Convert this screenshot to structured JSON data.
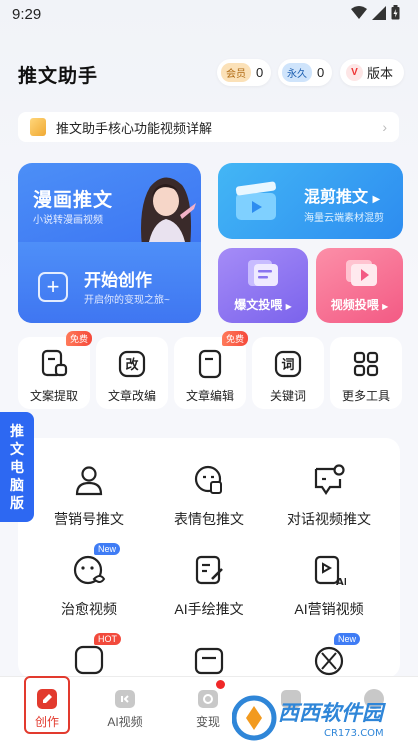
{
  "status_bar": {
    "time": "9:29"
  },
  "header": {
    "title": "推文助手",
    "member": {
      "tag": "会员",
      "count": "0"
    },
    "forever": {
      "tag": "永久",
      "count": "0"
    },
    "version": {
      "badge": "V",
      "label": "版本"
    }
  },
  "banner": {
    "text": "推文助手核心功能视频详解"
  },
  "cards": {
    "comic": {
      "title": "漫画推文",
      "subtitle": "小说转漫画视频"
    },
    "start": {
      "title": "开始创作",
      "subtitle": "开启你的变现之旅~"
    },
    "cut": {
      "title": "混剪推文",
      "subtitle": "海量云端素材混剪"
    },
    "hot": {
      "label": "爆文投喂"
    },
    "video": {
      "label": "视频投喂"
    }
  },
  "tools": [
    {
      "label": "文案提取",
      "badge": "免费",
      "icon": "doc-extract-icon"
    },
    {
      "label": "文章改编",
      "badge": "",
      "icon": "rewrite-icon",
      "glyph": "改"
    },
    {
      "label": "文章编辑",
      "badge": "免费",
      "icon": "doc-edit-icon"
    },
    {
      "label": "关键词",
      "badge": "",
      "icon": "keyword-icon",
      "glyph": "词"
    },
    {
      "label": "更多工具",
      "badge": "",
      "icon": "grid-icon"
    }
  ],
  "side_tab": {
    "chars": [
      "推",
      "文",
      "电",
      "脑",
      "版"
    ]
  },
  "features": [
    {
      "label": "营销号推文",
      "icon": "person-icon",
      "badge": ""
    },
    {
      "label": "表情包推文",
      "icon": "sticker-icon",
      "badge": ""
    },
    {
      "label": "对话视频推文",
      "icon": "chat-icon",
      "badge": ""
    },
    {
      "label": "治愈视频",
      "icon": "heal-face-icon",
      "badge": "New"
    },
    {
      "label": "AI手绘推文",
      "icon": "ai-draw-icon",
      "badge": ""
    },
    {
      "label": "AI营销视频",
      "icon": "ai-video-icon",
      "badge": ""
    },
    {
      "label": "",
      "icon": "ai-face-icon",
      "badge": "HOT"
    },
    {
      "label": "",
      "icon": "message-box-icon",
      "badge": ""
    },
    {
      "label": "",
      "icon": "aperture-icon",
      "badge": "New"
    }
  ],
  "bottom_nav": [
    {
      "label": "创作",
      "icon": "create-icon",
      "active": true
    },
    {
      "label": "AI视频",
      "icon": "ai-video-nav-icon"
    },
    {
      "label": "变现",
      "icon": "monetize-icon"
    },
    {
      "label": "",
      "icon": "tab-4-icon"
    },
    {
      "label": "",
      "icon": "profile-icon"
    }
  ],
  "watermark": {
    "brand": "西西软件园",
    "domain": "CR173.COM"
  },
  "colors": {
    "primary": "#3467f0",
    "accent_red": "#e23a2e",
    "purple": "#7b63ec",
    "pink": "#f35a84"
  }
}
